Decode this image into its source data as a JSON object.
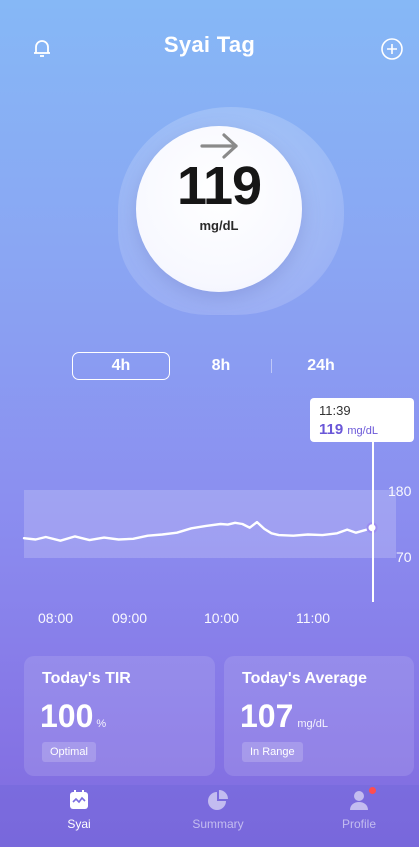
{
  "header": {
    "title": "Syai Tag"
  },
  "glucose": {
    "value": "119",
    "unit": "mg/dL",
    "trend": "steady"
  },
  "ranges": {
    "tabs": [
      "4h",
      "8h",
      "24h"
    ],
    "selected": "4h"
  },
  "chart": {
    "tooltip": {
      "time": "11:39",
      "value": "119",
      "unit": "mg/dL"
    },
    "x_ticks": [
      "08:00",
      "09:00",
      "10:00",
      "11:00"
    ],
    "y_ticks": [
      "180",
      "70"
    ],
    "target_range": [
      70,
      180
    ]
  },
  "chart_data": {
    "type": "line",
    "xlabel": "",
    "ylabel": "",
    "x": [
      "07:40",
      "07:48",
      "07:55",
      "08:05",
      "08:15",
      "08:25",
      "08:35",
      "08:45",
      "08:55",
      "09:05",
      "09:15",
      "09:25",
      "09:35",
      "09:45",
      "09:55",
      "10:00",
      "10:05",
      "10:10",
      "10:15",
      "10:20",
      "10:25",
      "10:30",
      "10:35",
      "10:45",
      "10:55",
      "11:05",
      "11:15",
      "11:22",
      "11:28",
      "11:34",
      "11:39"
    ],
    "values": [
      102,
      100,
      104,
      98,
      105,
      99,
      103,
      100,
      101,
      106,
      108,
      111,
      118,
      122,
      125,
      124,
      127,
      125,
      119,
      128,
      117,
      110,
      107,
      106,
      108,
      107,
      110,
      116,
      111,
      115,
      119
    ],
    "ylim": [
      40,
      230
    ],
    "target_range": [
      70,
      180
    ]
  },
  "cards": {
    "tir": {
      "title": "Today's TIR",
      "value": "100",
      "unit": "%",
      "badge": "Optimal"
    },
    "average": {
      "title": "Today's Average",
      "value": "107",
      "unit": "mg/dL",
      "badge": "In Range"
    }
  },
  "nav": {
    "items": [
      {
        "label": "Syai",
        "icon": "home-chart-icon",
        "active": true
      },
      {
        "label": "Summary",
        "icon": "pie-chart-icon",
        "active": false
      },
      {
        "label": "Profile",
        "icon": "profile-icon",
        "active": false,
        "badge": true
      }
    ]
  },
  "colors": {
    "accent": "#6a57d8",
    "badge_dot": "#ff4d4f"
  }
}
